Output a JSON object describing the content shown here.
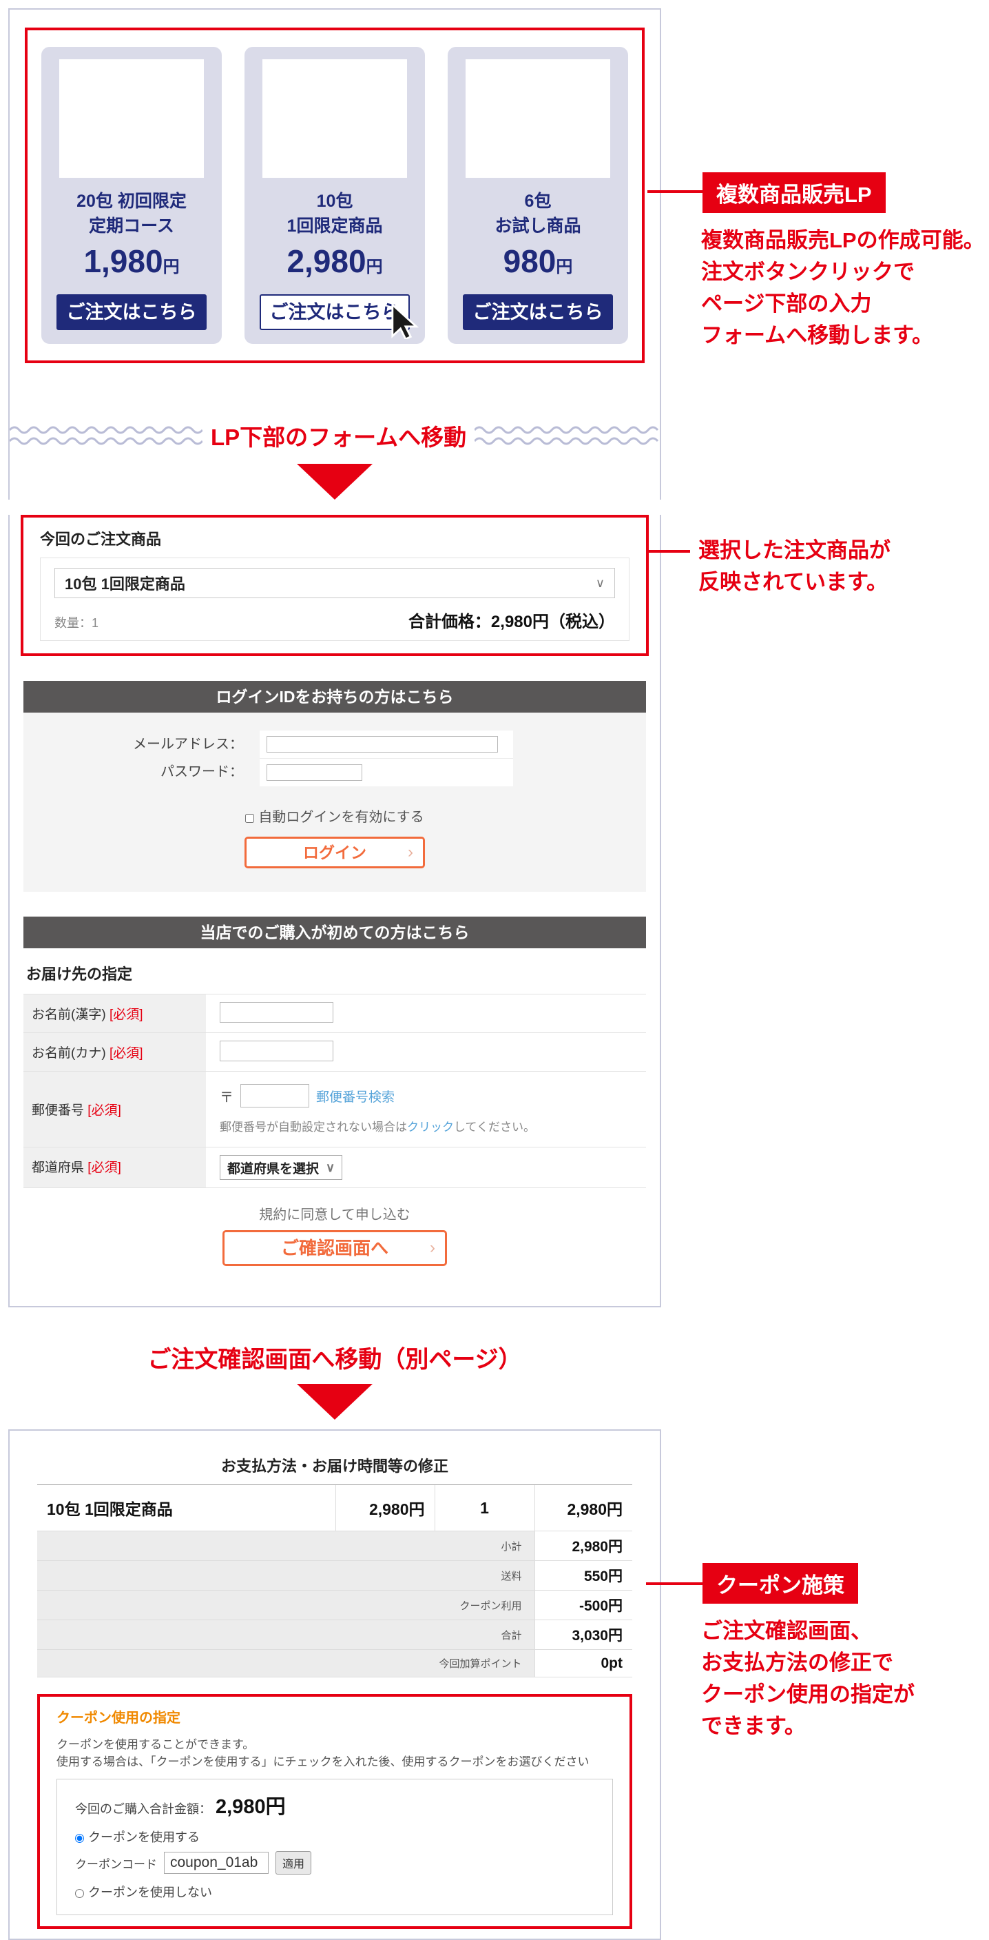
{
  "colors": {
    "red": "#e60012",
    "navy": "#1f2a7a",
    "lavender_border": "#c7c9db",
    "card_bg": "#dadbe9",
    "header_gray": "#595757",
    "orange": "#f26b3c",
    "coupon_orange": "#f08900",
    "link_blue": "#55a3d9"
  },
  "icons": {
    "chevron_down": "∨",
    "chevron_right": "›"
  },
  "lp": {
    "products": [
      {
        "name1": "20包 初回限定",
        "name2": "定期コース",
        "price": "1,980",
        "unit": "円",
        "button": "ご注文はこちら"
      },
      {
        "name1": "10包",
        "name2": "1回限定商品",
        "price": "2,980",
        "unit": "円",
        "button": "ご注文はこちら"
      },
      {
        "name1": "6包",
        "name2": "お試し商品",
        "price": "980",
        "unit": "円",
        "button": "ご注文はこちら"
      }
    ]
  },
  "tear": {
    "label": "LP下部のフォームへ移動"
  },
  "order_box": {
    "title": "今回のご注文商品",
    "select_value": "10包 1回限定商品",
    "qty_text": "数量：1",
    "total_text": "合計価格：2,980円（税込）"
  },
  "login": {
    "header": "ログインIDをお持ちの方はこちら",
    "email_label": "メールアドレス：",
    "password_label": "パスワード：",
    "checkbox_label": "自動ログインを有効にする",
    "button": "ログイン"
  },
  "signup": {
    "header": "当店でのご購入が初めての方はこちら",
    "subtitle": "お届け先の指定",
    "required_label": "[必須]",
    "row_name_kanji": "お名前(漢字)",
    "row_name_kana": "お名前(カナ)",
    "row_postal": "郵便番号",
    "postal_mark": "〒",
    "postal_link": "郵便番号検索",
    "postal_help_pre": "郵便番号が自動設定されない場合は",
    "postal_help_link": "クリック",
    "postal_help_post": "してください。",
    "row_pref": "都道府県",
    "pref_select": "都道府県を選択",
    "agree_text": "規約に同意して申し込む",
    "confirm_button": "ご確認画面へ"
  },
  "arrow2": {
    "label": "ご注文確認画面へ移動（別ページ）"
  },
  "payment": {
    "title": "お支払方法・お届け時間等の修正",
    "item": {
      "name": "10包 1回限定商品",
      "price": "2,980円",
      "qty": "1",
      "total": "2,980円"
    },
    "totals": [
      {
        "label": "小計",
        "value": "2,980円"
      },
      {
        "label": "送料",
        "value": "550円"
      },
      {
        "label": "クーポン利用",
        "value": "-500円"
      },
      {
        "label": "合計",
        "value": "3,030円"
      },
      {
        "label": "今回加算ポイント",
        "value": "0pt"
      }
    ]
  },
  "coupon": {
    "heading": "クーポン使用の指定",
    "desc1": "クーポンを使用することができます。",
    "desc2": "使用する場合は、「クーポンを使用する」にチェックを入れた後、使用するクーポンをお選びください",
    "total_label": "今回のご購入合計金額：",
    "total_value": "2,980円",
    "radio_use": "クーポンを使用する",
    "code_label": "クーポンコード",
    "code_value": "coupon_01ab",
    "apply_button": "適用",
    "radio_no": "クーポンを使用しない"
  },
  "annotations": [
    {
      "badge": "複数商品販売LP",
      "lines": [
        "複数商品販売LPの作成可能。",
        "注文ボタンクリックで",
        "ページ下部の入力",
        "フォームへ移動します。"
      ]
    },
    {
      "lines": [
        "選択した注文商品が",
        "反映されています。"
      ]
    },
    {
      "badge": "クーポン施策",
      "lines": [
        "ご注文確認画面、",
        "お支払方法の修正で",
        "クーポン使用の指定が",
        "できます。"
      ]
    }
  ]
}
